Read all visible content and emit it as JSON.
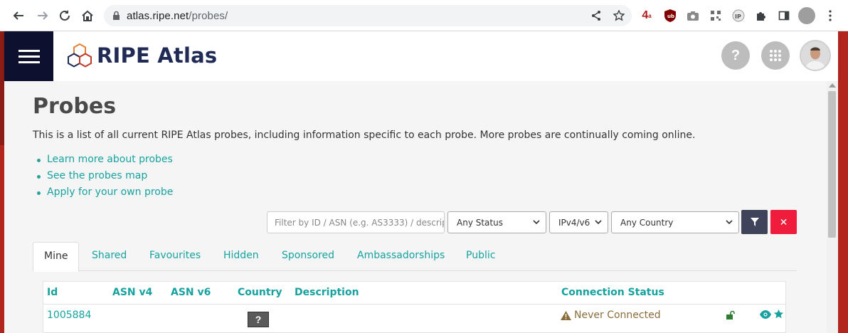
{
  "browser": {
    "url_host": "atlas.ripe.net",
    "url_path": "/probes/",
    "ext_badge_text": "4"
  },
  "header": {
    "logo_text": "RIPE Atlas",
    "help_label": "?"
  },
  "page": {
    "title": "Probes",
    "intro": "This is a list of all current RIPE Atlas probes, including information specific to each probe. More probes are continually coming online.",
    "links": [
      "Learn more about probes",
      "See the probes map",
      "Apply for your own probe"
    ]
  },
  "filters": {
    "search_placeholder": "Filter by ID / ASN (e.g. AS3333) / descripti",
    "status_selected": "Any Status",
    "ip_selected": "IPv4/v6",
    "country_selected": "Any Country",
    "clear_label": "✕"
  },
  "tabs": [
    "Mine",
    "Shared",
    "Favourites",
    "Hidden",
    "Sponsored",
    "Ambassadorships",
    "Public"
  ],
  "table": {
    "headers": {
      "id": "Id",
      "asn_v4": "ASN v4",
      "asn_v6": "ASN v6",
      "country": "Country",
      "description": "Description",
      "connection_status": "Connection Status"
    },
    "rows": [
      {
        "id": "1005884",
        "country": "?",
        "status": "Never Connected"
      }
    ]
  },
  "colors": {
    "accent": "#17a2a0",
    "nav_dark": "#0e1030",
    "danger": "#ef1c3c",
    "warning": "#8a6d3b"
  }
}
